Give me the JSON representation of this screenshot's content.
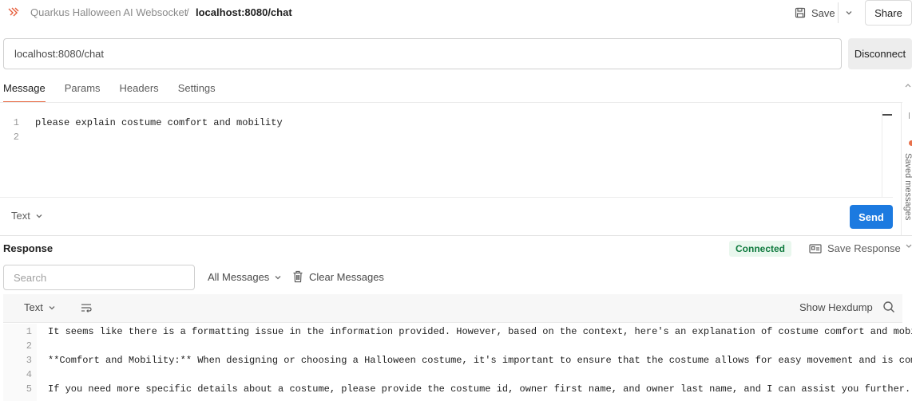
{
  "header": {
    "collection_name": "Quarkus Halloween AI Websocket",
    "separator": "/",
    "request_name": "localhost:8080/chat",
    "save_label": "Save",
    "share_label": "Share"
  },
  "url_bar": {
    "value": "localhost:8080/chat",
    "disconnect_label": "Disconnect"
  },
  "tabs": [
    {
      "label": "Message",
      "active": true
    },
    {
      "label": "Params",
      "active": false
    },
    {
      "label": "Headers",
      "active": false
    },
    {
      "label": "Settings",
      "active": false
    }
  ],
  "editor": {
    "lines": [
      {
        "num": "1",
        "text": "please explain costume comfort and mobility"
      },
      {
        "num": "2",
        "text": ""
      }
    ],
    "message_type": "Text",
    "send_label": "Send"
  },
  "right_rail": {
    "label": "Saved messages"
  },
  "response": {
    "title": "Response",
    "status": "Connected",
    "save_response_label": "Save Response",
    "search_placeholder": "Search",
    "filter_label": "All Messages",
    "clear_label": "Clear Messages",
    "format_label": "Text",
    "hexdump_label": "Show Hexdump",
    "lines": [
      {
        "num": "1",
        "text": "It seems like there is a formatting issue in the information provided. However, based on the context, here's an explanation of costume comfort and mobility:"
      },
      {
        "num": "2",
        "text": ""
      },
      {
        "num": "3",
        "text": "**Comfort and Mobility:** When designing or choosing a Halloween costume, it's important to ensure that the costume allows for easy movement and is comfortable to wear."
      },
      {
        "num": "4",
        "text": ""
      },
      {
        "num": "5",
        "text": "If you need more specific details about a costume, please provide the costume id, owner first name, and owner last name, and I can assist you further."
      }
    ]
  },
  "colors": {
    "accent": "#e8704b",
    "primary_button": "#1c7ae0",
    "connected_text": "#0f7a3e",
    "connected_bg": "#e9f7ee"
  },
  "icons": [
    "websocket-icon",
    "save-icon",
    "chevron-down-icon",
    "save-response-icon",
    "trash-icon",
    "wrap-lines-icon",
    "search-icon"
  ]
}
